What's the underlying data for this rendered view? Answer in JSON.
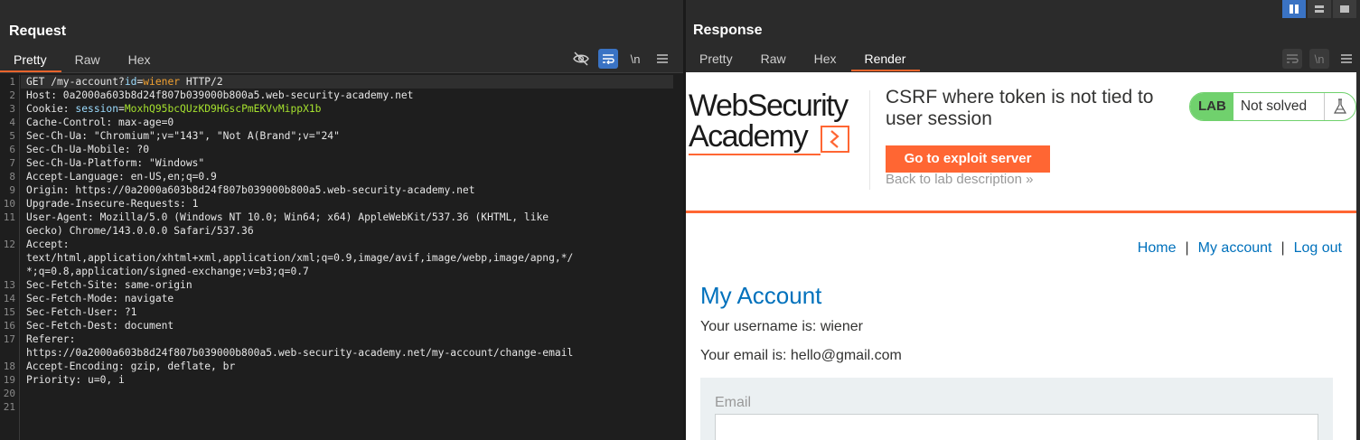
{
  "request": {
    "title": "Request",
    "tabs": [
      "Pretty",
      "Raw",
      "Hex"
    ],
    "active_tab": "Pretty",
    "toolbar": [
      "hide-icon",
      "wrap-icon",
      "newline-icon",
      "menu-icon"
    ],
    "newline_label": "\\n",
    "line_numbers": [
      "1",
      "2",
      "3",
      "4",
      "5",
      "6",
      "7",
      "8",
      "9",
      "10",
      "11",
      "12",
      "13",
      "14",
      "15",
      "16",
      "17",
      "18",
      "19",
      "20",
      "21"
    ],
    "lines": {
      "l1_method": "GET /my-account?",
      "l1_key": "id",
      "l1_eq": "=",
      "l1_val": "wiener",
      "l1_rest": " HTTP/2",
      "l2": "Host: 0a2000a603b8d24f807b039000b800a5.web-security-academy.net",
      "l3_name": "Cookie: ",
      "l3_key": "session",
      "l3_eq": "=",
      "l3_val": "MoxhQ95bcQUzKD9HGscPmEKVvMippX1b",
      "l4": "Cache-Control: max-age=0",
      "l5": "Sec-Ch-Ua: \"Chromium\";v=\"143\", \"Not A(Brand\";v=\"24\"",
      "l6": "Sec-Ch-Ua-Mobile: ?0",
      "l7": "Sec-Ch-Ua-Platform: \"Windows\"",
      "l8": "Accept-Language: en-US,en;q=0.9",
      "l9": "Origin: https://0a2000a603b8d24f807b039000b800a5.web-security-academy.net",
      "l10": "Upgrade-Insecure-Requests: 1",
      "l11a": "User-Agent: Mozilla/5.0 (Windows NT 10.0; Win64; x64) AppleWebKit/537.36 (KHTML, like",
      "l11b": "Gecko) Chrome/143.0.0.0 Safari/537.36",
      "l12a": "Accept:",
      "l12b": "text/html,application/xhtml+xml,application/xml;q=0.9,image/avif,image/webp,image/apng,*/",
      "l12c": "*;q=0.8,application/signed-exchange;v=b3;q=0.7",
      "l13": "Sec-Fetch-Site: same-origin",
      "l14": "Sec-Fetch-Mode: navigate",
      "l15": "Sec-Fetch-User: ?1",
      "l16": "Sec-Fetch-Dest: document",
      "l17a": "Referer:",
      "l17b": "https://0a2000a603b8d24f807b039000b800a5.web-security-academy.net/my-account/change-email",
      "l18": "Accept-Encoding: gzip, deflate, br",
      "l19": "Priority: u=0, i"
    }
  },
  "response": {
    "title": "Response",
    "tabs": [
      "Pretty",
      "Raw",
      "Hex",
      "Render"
    ],
    "active_tab": "Render",
    "newline_label": "\\n",
    "render": {
      "logo_line1": "WebSecurity",
      "logo_line2": "Academy",
      "lab_title": "CSRF where token is not tied to user session",
      "exploit_button": "Go to exploit server",
      "back_link": "Back to lab description",
      "back_chevron": "»",
      "lab_tag": "LAB",
      "lab_status": "Not solved",
      "nav": [
        "Home",
        "My account",
        "Log out"
      ],
      "nav_sep": "|",
      "heading": "My Account",
      "username_line": "Your username is: wiener",
      "email_line": "Your email is: hello@gmail.com",
      "email_label": "Email"
    }
  },
  "colors": {
    "accent_orange": "#ff6633",
    "link_blue": "#0071bc",
    "lab_green": "#70d16d",
    "toolbar_blue": "#3a73c4"
  }
}
